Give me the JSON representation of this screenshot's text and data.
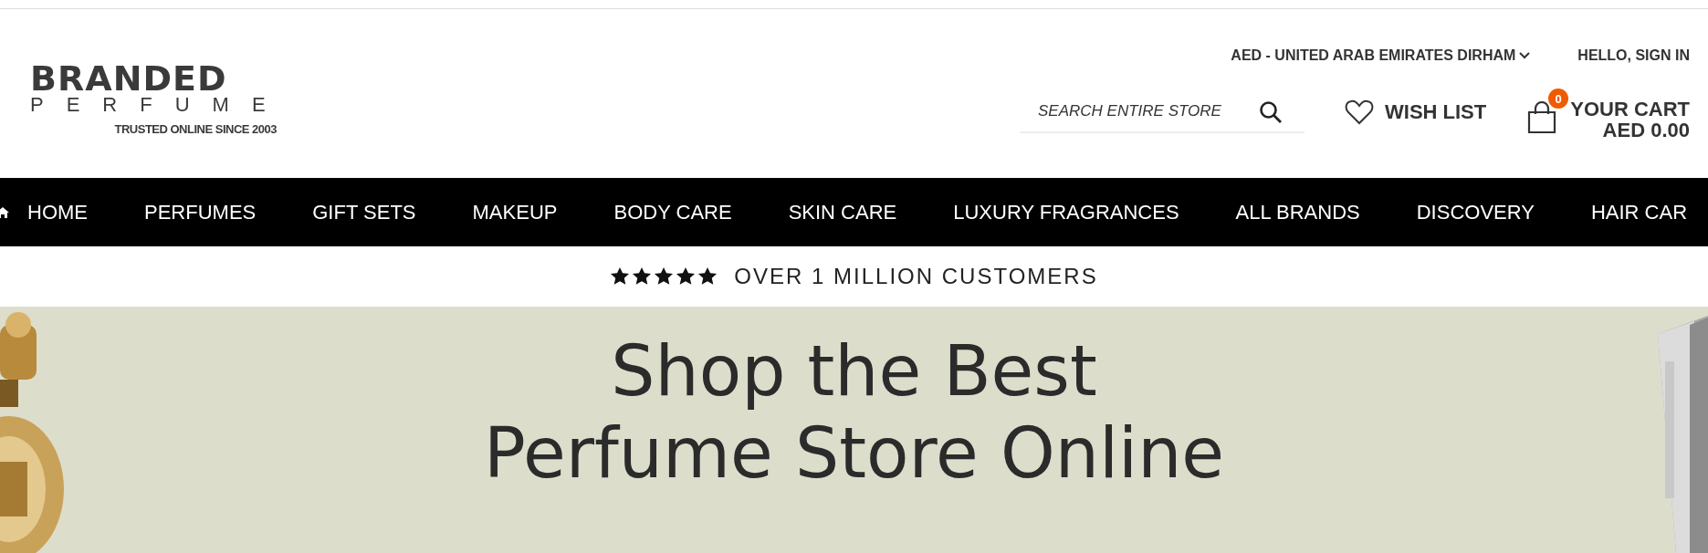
{
  "logo": {
    "name": "BRANDED",
    "sub": "PERFUME",
    "tagline": "TRUSTED ONLINE SINCE 2003"
  },
  "top_links": [
    {
      "label": "AED - UNITED ARAB EMIRATES DIRHAM",
      "kind": "dropdown"
    },
    {
      "label": "HELLO, SIGN IN",
      "kind": "link"
    }
  ],
  "search": {
    "placeholder": "SEARCH ENTIRE STORE"
  },
  "wishlist": {
    "label": "WISH LIST"
  },
  "cart": {
    "count": "0",
    "label": "YOUR CART",
    "total": "AED 0.00"
  },
  "nav": [
    "HOME",
    "PERFUMES",
    "GIFT SETS",
    "MAKEUP",
    "BODY CARE",
    "SKIN CARE",
    "LUXURY FRAGRANCES",
    "ALL BRANDS",
    "DISCOVERY",
    "HAIR CAR"
  ],
  "rating": {
    "stars": 5,
    "text": "OVER 1 MILLION CUSTOMERS"
  },
  "hero": {
    "title": [
      "Shop the Best",
      "Perfume Store Online"
    ]
  }
}
